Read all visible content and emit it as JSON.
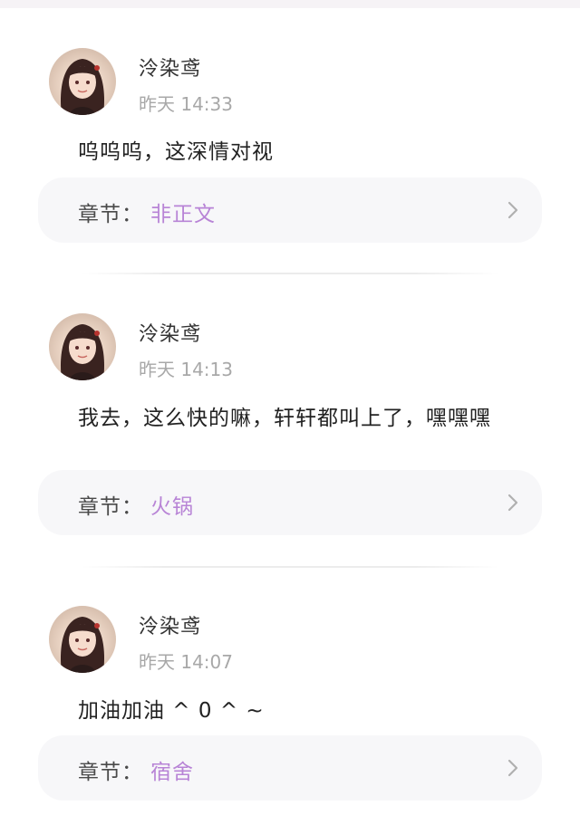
{
  "comments": [
    {
      "username": "泠染鸢",
      "timestamp": "昨天 14:33",
      "content": "呜呜呜，这深情对视",
      "chapter_label": "章节：",
      "chapter_name": "非正文"
    },
    {
      "username": "泠染鸢",
      "timestamp": "昨天 14:13",
      "content": "我去，这么快的嘛，轩轩都叫上了，嘿嘿嘿",
      "chapter_label": "章节：",
      "chapter_name": "火锅"
    },
    {
      "username": "泠染鸢",
      "timestamp": "昨天 14:07",
      "content": "加油加油 ^ 0 ^ ~",
      "chapter_label": "章节：",
      "chapter_name": "宿舍"
    }
  ],
  "colors": {
    "accent": "#b884d6",
    "chapter_bg": "#f7f7f9",
    "timestamp": "#a8a8a8"
  },
  "icons": {
    "chevron": "chevron-right-icon"
  }
}
